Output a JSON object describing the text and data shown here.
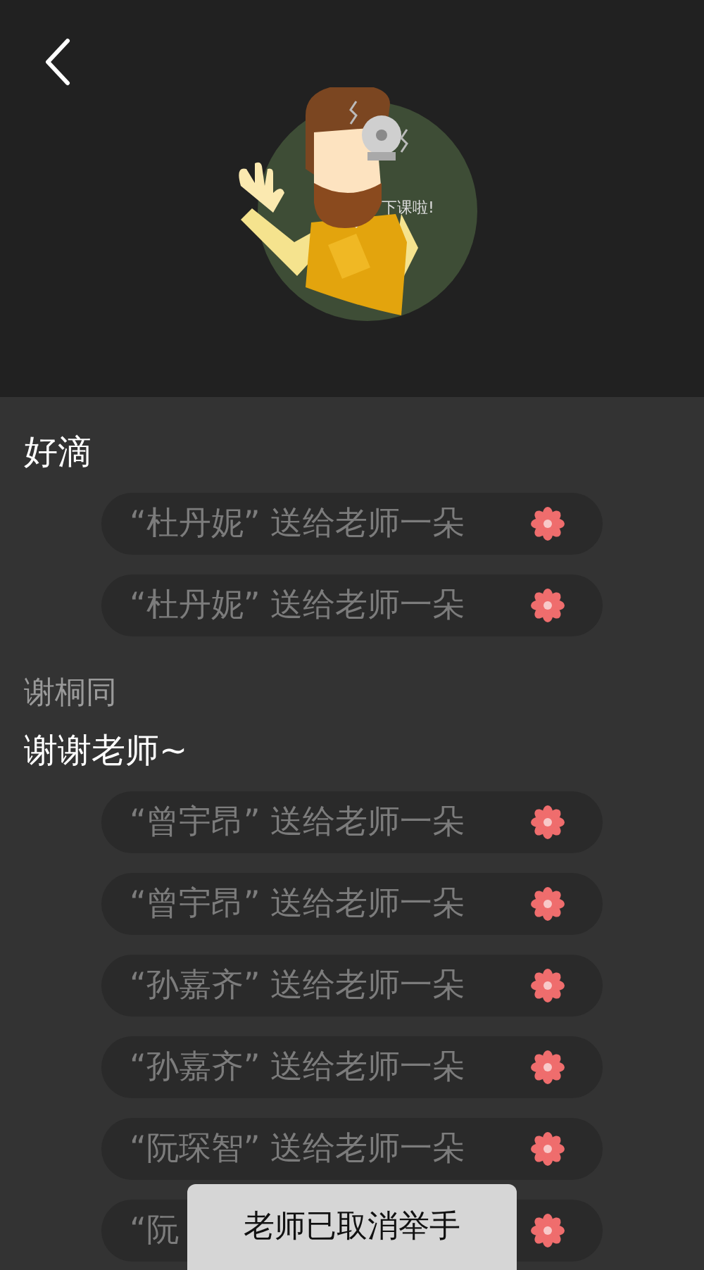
{
  "illustration": {
    "caption": "下课啦!"
  },
  "groups": [
    {
      "message": "好滴",
      "gifts": [
        {
          "text": "“杜丹妮” 送给老师一朵"
        },
        {
          "text": "“杜丹妮” 送给老师一朵"
        }
      ]
    },
    {
      "author": "谢桐同",
      "message": "谢谢老师~",
      "gifts": [
        {
          "text": "“曾宇昂” 送给老师一朵"
        },
        {
          "text": "“曾宇昂” 送给老师一朵"
        },
        {
          "text": "“孙嘉齐” 送给老师一朵"
        },
        {
          "text": "“孙嘉齐” 送给老师一朵"
        },
        {
          "text": "“阮琛智” 送给老师一朵"
        },
        {
          "text": "“阮"
        }
      ]
    }
  ],
  "toast": "老师已取消举手"
}
